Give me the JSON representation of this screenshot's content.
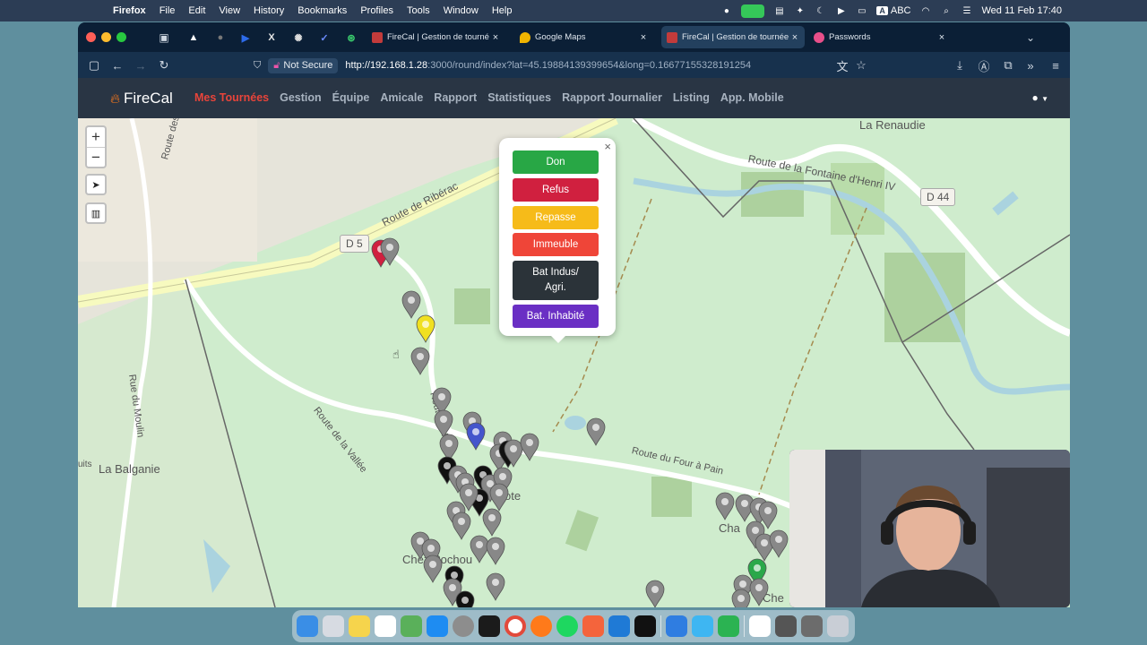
{
  "menubar": {
    "app_name": "Firefox",
    "menus": [
      "File",
      "Edit",
      "View",
      "History",
      "Bookmarks",
      "Profiles",
      "Tools",
      "Window",
      "Help"
    ],
    "input_source": "ABC",
    "datetime": "Wed 11 Feb  17:40"
  },
  "tabs": [
    {
      "title": "FireCal | Gestion de tournées ca",
      "active": false
    },
    {
      "title": "Google Maps",
      "active": false
    },
    {
      "title": "FireCal | Gestion de tournées ca",
      "active": true
    },
    {
      "title": "Passwords",
      "active": false
    }
  ],
  "address_bar": {
    "security_label": "Not Secure",
    "url_host": "http://192.168.1.28",
    "url_path": ":3000/round/index?lat=45.19884139399654&long=0.16677155328191254"
  },
  "app": {
    "brand": "FireCal",
    "nav": [
      {
        "label": "Mes Tournées",
        "active": true
      },
      {
        "label": "Gestion",
        "active": false
      },
      {
        "label": "Équipe",
        "active": false
      },
      {
        "label": "Amicale",
        "active": false
      },
      {
        "label": "Rapport",
        "active": false
      },
      {
        "label": "Statistiques",
        "active": false
      },
      {
        "label": "Rapport Journalier",
        "active": false
      },
      {
        "label": "Listing",
        "active": false
      },
      {
        "label": "App. Mobile",
        "active": false
      }
    ],
    "active_color": "#e8443a"
  },
  "map": {
    "zoom_in": "+",
    "zoom_out": "−",
    "labels": {
      "la_renaudie": "La Renaudie",
      "route_fontaine": "Route de la Fontaine d'Henri IV",
      "d44": "D 44",
      "d5": "D 5",
      "route_riberac": "Route de Ribérac",
      "route_moulin": "Rue du Moulin",
      "route_vallee": "Route de la Vallée",
      "la_balganie": "La Balganie",
      "route_four": "Route du Four à Pain",
      "route_four_short": "Route du Fou",
      "chez_pochou": "Chez Pochou",
      "chez": "Che",
      "cha": "Cha",
      "ote": "ote",
      "uits": "uits",
      "route_des": "Route des"
    }
  },
  "popup": {
    "close": "×",
    "buttons": [
      {
        "label": "Don",
        "color": "#28a745"
      },
      {
        "label": "Refus",
        "color": "#d0203f"
      },
      {
        "label": "Repasse",
        "color": "#f6bb19"
      },
      {
        "label": "Immeuble",
        "color": "#ef4538"
      },
      {
        "label": "Bat Indus/ Agri.",
        "color": "#2b3339"
      },
      {
        "label": "Bat. Inhabité",
        "color": "#6a2fc4"
      }
    ]
  }
}
